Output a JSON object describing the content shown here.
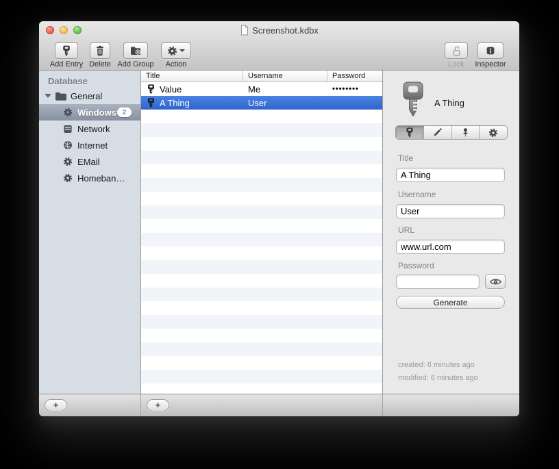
{
  "window": {
    "title": "Screenshot.kdbx"
  },
  "toolbar": {
    "items": [
      {
        "label": "Add Entry",
        "icon": "key-icon",
        "enabled": true
      },
      {
        "label": "Delete",
        "icon": "trash-icon",
        "enabled": true
      },
      {
        "label": "Add Group",
        "icon": "folder-plus-icon",
        "enabled": true
      },
      {
        "label": "Action",
        "icon": "gear-icon",
        "has_dropdown": true,
        "enabled": true
      },
      {
        "label": "Lock",
        "icon": "lock-open-icon",
        "enabled": false
      },
      {
        "label": "Inspector",
        "icon": "info-icon",
        "enabled": true
      }
    ]
  },
  "sidebar": {
    "header": "Database",
    "items": [
      {
        "label": "General",
        "icon": "folder-icon",
        "depth": 0,
        "expanded": true,
        "selected": false
      },
      {
        "label": "Windows",
        "icon": "gear-icon",
        "depth": 1,
        "selected": true,
        "badge": "2"
      },
      {
        "label": "Network",
        "icon": "server-icon",
        "depth": 1,
        "selected": false
      },
      {
        "label": "Internet",
        "icon": "globe-icon",
        "depth": 1,
        "selected": false
      },
      {
        "label": "EMail",
        "icon": "gear-icon",
        "depth": 1,
        "selected": false
      },
      {
        "label": "Homeban…",
        "icon": "gear-icon",
        "depth": 1,
        "selected": false
      }
    ],
    "add_button": "+"
  },
  "entry_table": {
    "columns": [
      "Title",
      "Username",
      "Password"
    ],
    "rows": [
      {
        "title": "Value",
        "username": "Me",
        "password": "••••••••",
        "selected": false
      },
      {
        "title": "A Thing",
        "username": "User",
        "password": "",
        "selected": true
      }
    ],
    "add_button": "+"
  },
  "inspector": {
    "entry_title": "A Thing",
    "tabs": [
      "key-tab",
      "edit-tab",
      "pin-tab",
      "settings-tab"
    ],
    "selected_tab": "key-tab",
    "fields": [
      {
        "label": "Title",
        "value": "A Thing"
      },
      {
        "label": "Username",
        "value": "User"
      },
      {
        "label": "URL",
        "value": "www.url.com"
      },
      {
        "label": "Password",
        "value": "",
        "has_reveal": true
      }
    ],
    "generate_label": "Generate",
    "created": "created: 6 minutes ago",
    "modified": "modified: 6 minutes ago"
  }
}
